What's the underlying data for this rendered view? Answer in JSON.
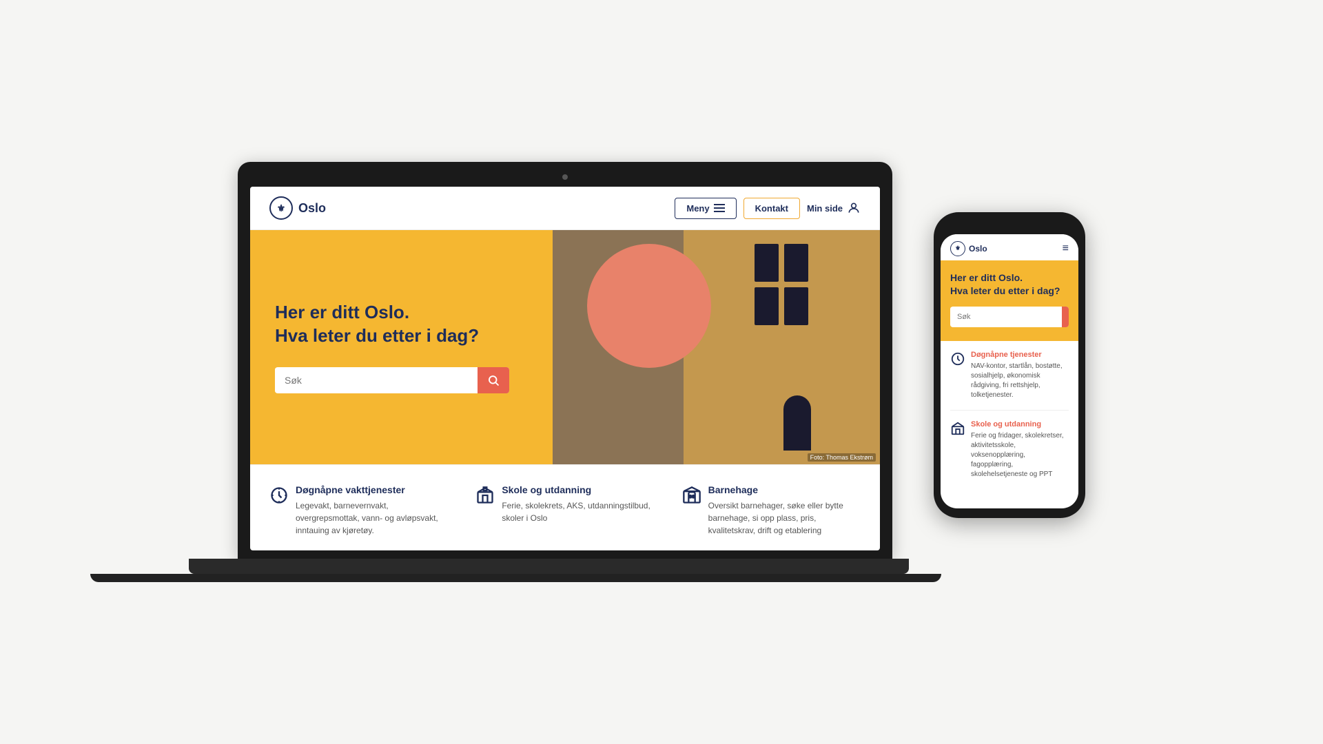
{
  "laptop": {
    "nav": {
      "logo_text": "Oslo",
      "btn_meny": "Meny",
      "btn_kontakt": "Kontakt",
      "btn_minside": "Min side"
    },
    "hero": {
      "headline_line1": "Her er ditt Oslo.",
      "headline_line2": "Hva leter du etter i dag?",
      "search_placeholder": "Søk",
      "photo_credit": "Foto: Thomas Ekstrøm"
    },
    "categories": [
      {
        "id": "vakt",
        "title": "Døgnåpne vakttjenester",
        "desc": "Legevakt, barnevernvakt, overgrepsmottak, vann- og avløpsvakt, inntauing av kjøretøy.",
        "icon": "clock"
      },
      {
        "id": "skole",
        "title": "Skole og utdanning",
        "desc": "Ferie, skolekrets, AKS, utdanningstilbud, skoler i Oslo",
        "icon": "school"
      },
      {
        "id": "barnehage",
        "title": "Barnehage",
        "desc": "Oversikt barnehager, søke eller bytte barnehage, si opp plass, pris, kvalitetskrav, drift og etablering",
        "icon": "building"
      }
    ]
  },
  "phone": {
    "nav": {
      "logo_text": "Oslo"
    },
    "hero": {
      "headline": "Her er ditt Oslo.\nHva leter du etter i dag?",
      "search_placeholder": "Søk"
    },
    "categories": [
      {
        "id": "dognapne",
        "title": "Døgnåpne tjenester",
        "desc": "NAV-kontor, startlån, bostøtte, sosialhjelp, økonomisk rådgiving, fri rettshjelp, tolketjenester.",
        "icon": "clock"
      },
      {
        "id": "skole",
        "title": "Skole og utdanning",
        "desc": "Ferie og fridager, skolekretser, aktivitetsskole, voksenopplæring, fagopplæring, skolehelsetjeneste og PPT",
        "icon": "school"
      }
    ]
  },
  "colors": {
    "yellow": "#f5b731",
    "salmon": "#e8614e",
    "navy": "#1e2d5a",
    "circle": "#e8826a"
  }
}
